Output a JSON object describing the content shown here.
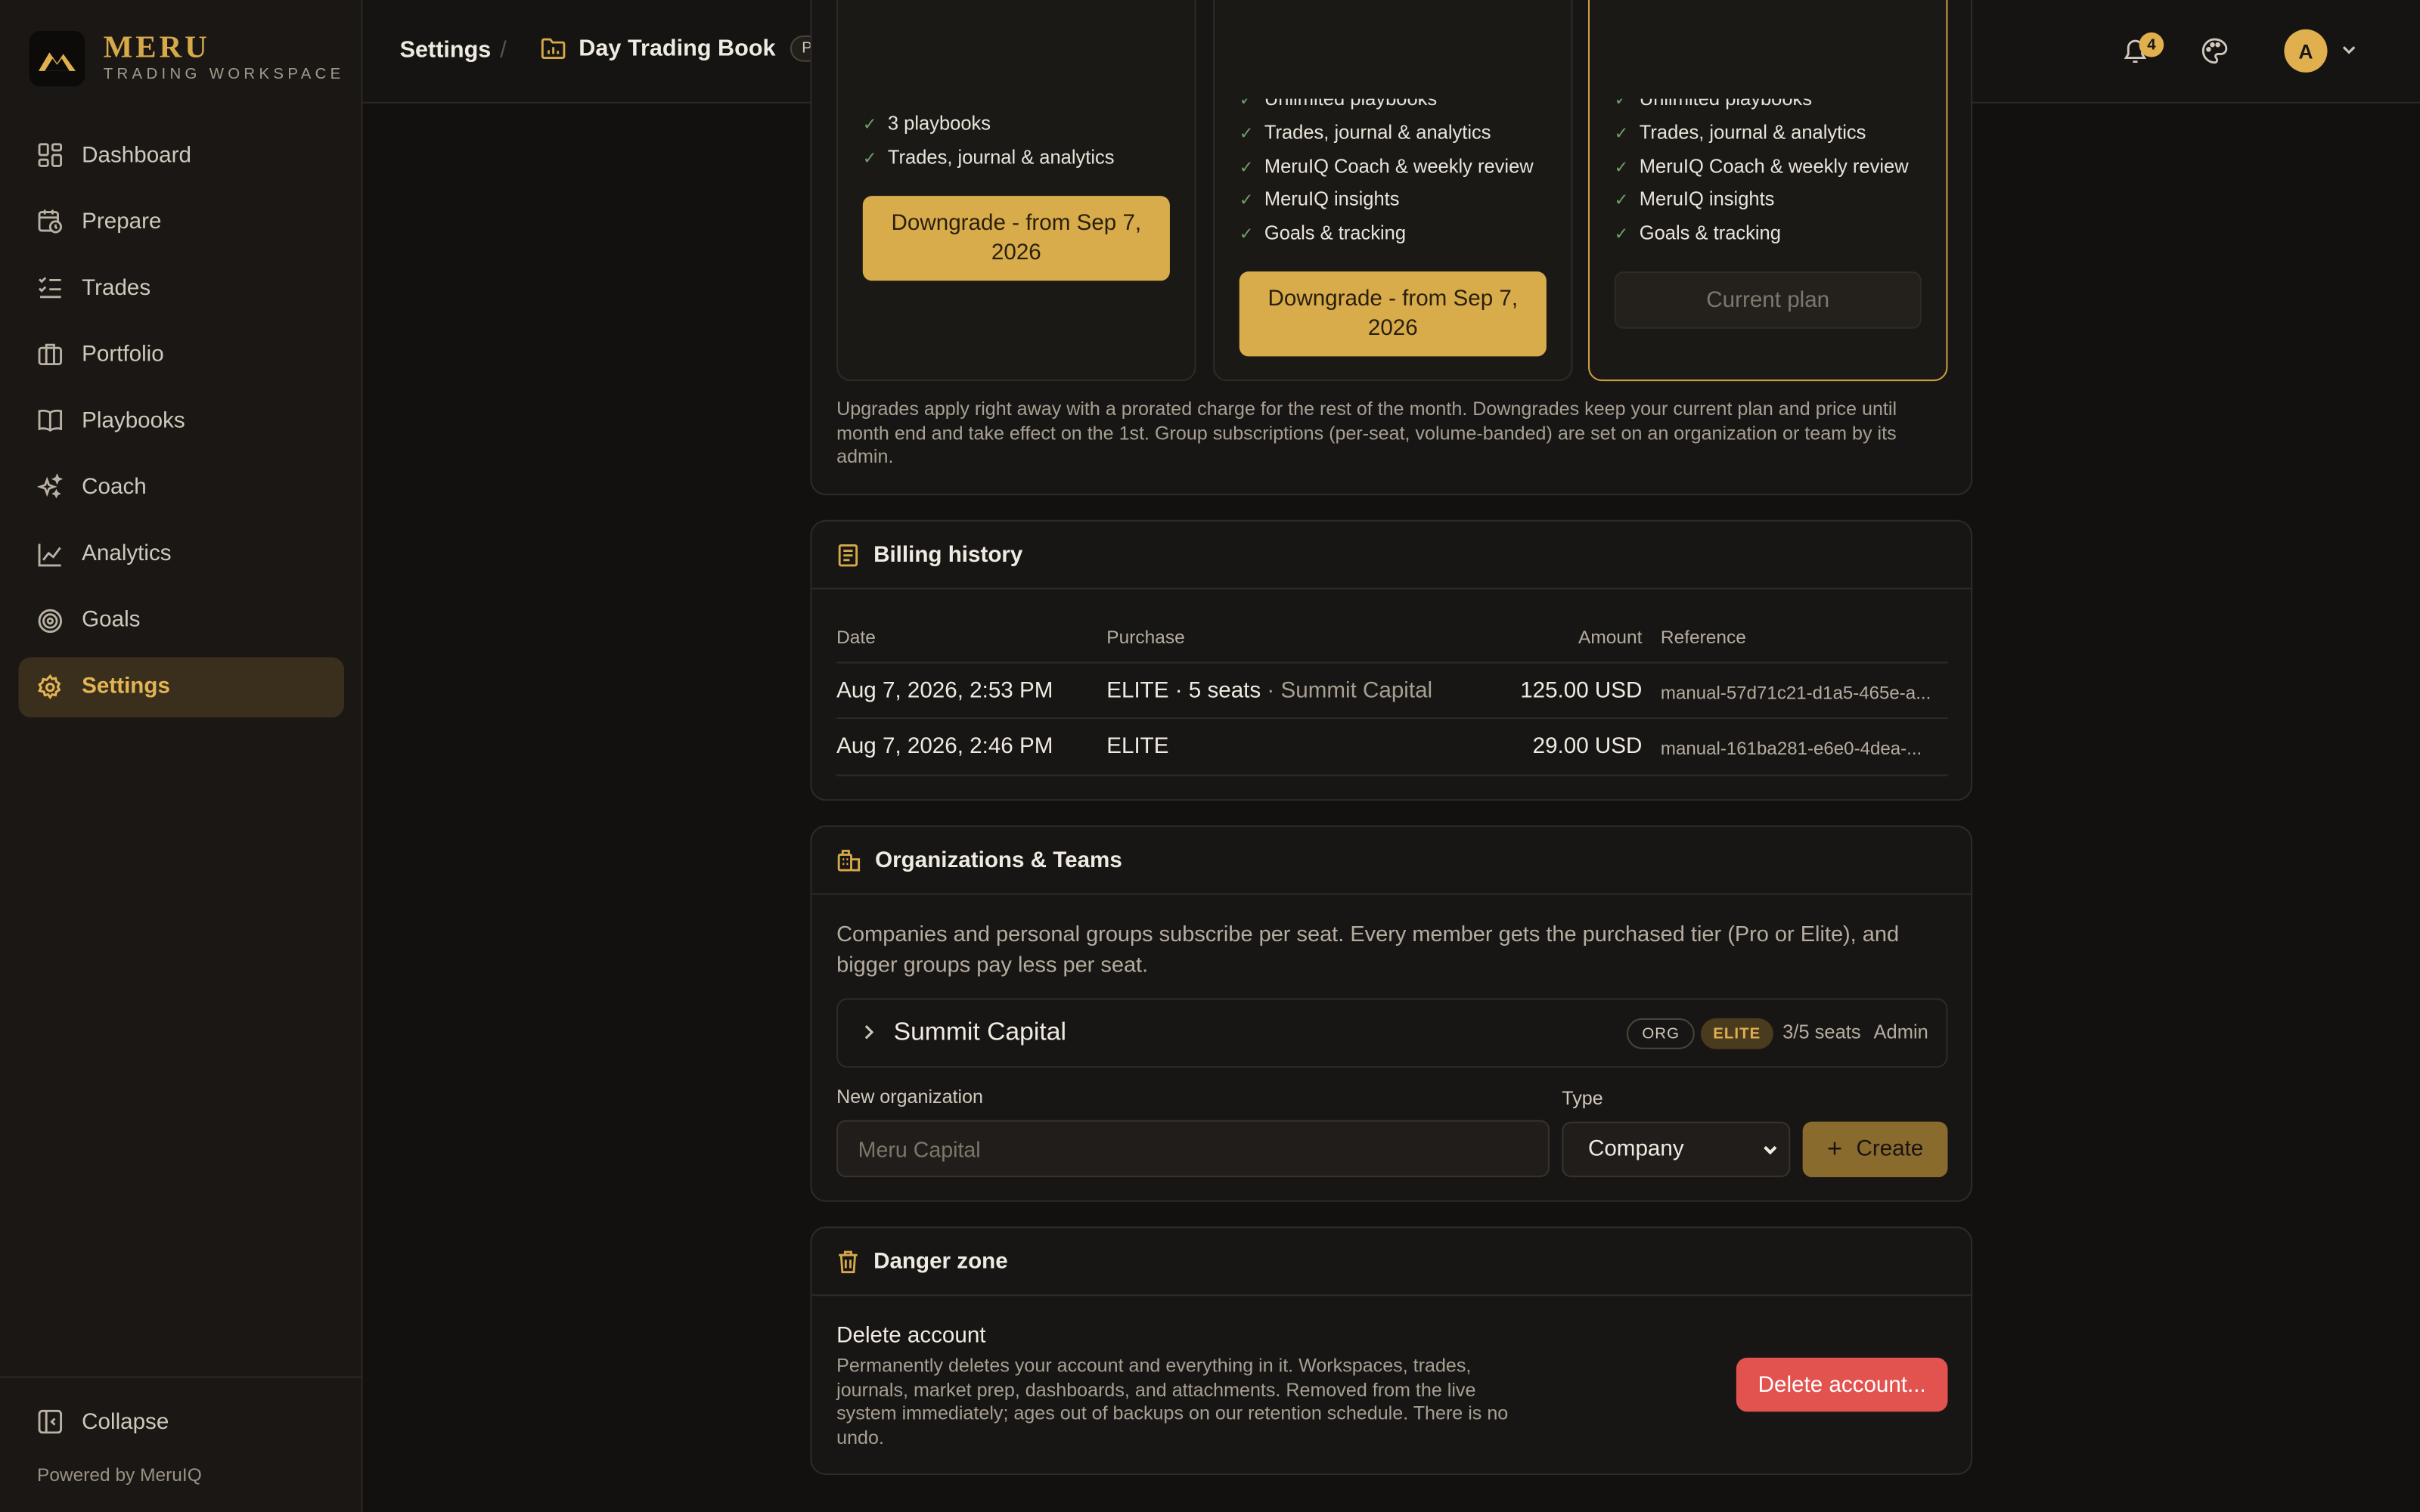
{
  "brand": {
    "name": "MERU",
    "subtitle": "TRADING WORKSPACE"
  },
  "sidebar": {
    "items": [
      {
        "label": "Dashboard",
        "icon": "dashboard-icon"
      },
      {
        "label": "Prepare",
        "icon": "calendar-clock-icon"
      },
      {
        "label": "Trades",
        "icon": "list-check-icon"
      },
      {
        "label": "Portfolio",
        "icon": "briefcase-icon"
      },
      {
        "label": "Playbooks",
        "icon": "book-icon"
      },
      {
        "label": "Coach",
        "icon": "sparkles-icon"
      },
      {
        "label": "Analytics",
        "icon": "line-chart-icon"
      },
      {
        "label": "Goals",
        "icon": "target-icon"
      },
      {
        "label": "Settings",
        "icon": "gear-icon",
        "active": true
      }
    ],
    "collapse_label": "Collapse",
    "powered_by": "Powered by MeruIQ"
  },
  "header": {
    "section": "Settings",
    "separator": "/",
    "book_name": "Day Trading Book",
    "book_badge": "Personal",
    "notifications_count": "4",
    "avatar_initial": "A"
  },
  "plans": {
    "left": {
      "features": [
        "3 playbooks",
        "Trades, journal & analytics"
      ],
      "button": "Downgrade - from Sep 7, 2026"
    },
    "middle": {
      "features": [
        "Unlimited playbooks",
        "Trades, journal & analytics",
        "MeruIQ Coach & weekly review",
        "MeruIQ insights",
        "Goals & tracking"
      ],
      "button": "Downgrade - from Sep 7, 2026"
    },
    "right": {
      "features": [
        "Unlimited playbooks",
        "Trades, journal & analytics",
        "MeruIQ Coach & weekly review",
        "MeruIQ insights",
        "Goals & tracking"
      ],
      "button": "Current plan"
    },
    "note": "Upgrades apply right away with a prorated charge for the rest of the month. Downgrades keep your current plan and price until month end and take effect on the 1st. Group subscriptions (per-seat, volume-banded) are set on an organization or team by its admin."
  },
  "billing": {
    "title": "Billing history",
    "columns": [
      "Date",
      "Purchase",
      "Amount",
      "Reference"
    ],
    "rows": [
      {
        "date": "Aug 7, 2026, 2:53 PM",
        "purchase": "ELITE · 5 seats",
        "org": "· Summit Capital",
        "amount": "125.00 USD",
        "reference": "manual-57d71c21-d1a5-465e-a..."
      },
      {
        "date": "Aug 7, 2026, 2:46 PM",
        "purchase": "ELITE",
        "org": "",
        "amount": "29.00 USD",
        "reference": "manual-161ba281-e6e0-4dea-..."
      }
    ]
  },
  "orgs": {
    "title": "Organizations & Teams",
    "description": "Companies and personal groups subscribe per seat. Every member gets the purchased tier (Pro or Elite), and bigger groups pay less per seat.",
    "org": {
      "name": "Summit Capital",
      "type_tag": "ORG",
      "tier_tag": "ELITE",
      "seats": "3/5 seats",
      "role": "Admin"
    },
    "new_org_label": "New organization",
    "new_org_placeholder": "Meru Capital",
    "type_label": "Type",
    "type_value": "Company",
    "create_label": "Create"
  },
  "danger": {
    "title": "Danger zone",
    "delete_title": "Delete account",
    "delete_desc": "Permanently deletes your account and everything in it. Workspaces, trades, journals, market prep, dashboards, and attachments. Removed from the live system immediately; ages out of backups on our retention schedule. There is no undo.",
    "delete_button": "Delete account..."
  },
  "colors": {
    "accent": "#d8ac4b",
    "background": "#131110",
    "danger": "#e2534f"
  }
}
